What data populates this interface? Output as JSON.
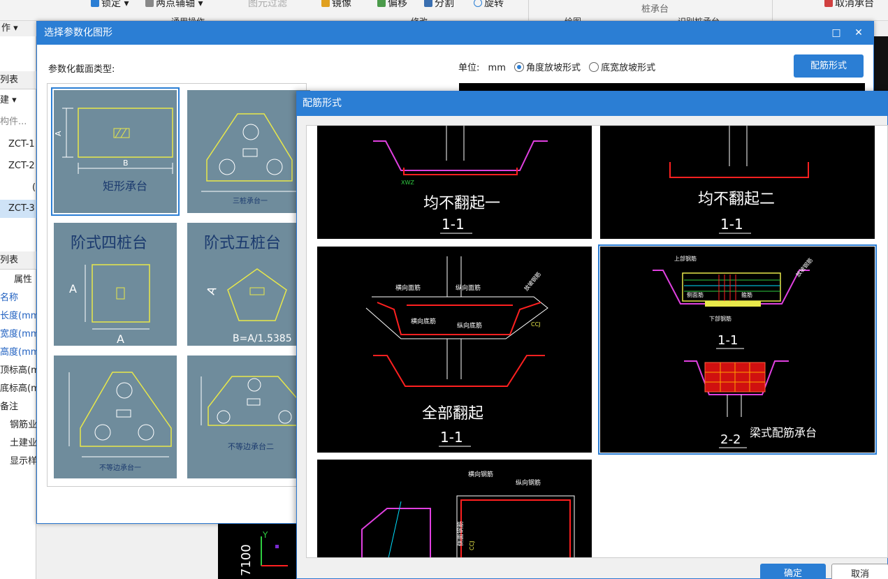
{
  "ribbon": {
    "lock": "锁定",
    "two_point_axis": "两点辅轴",
    "element_filter": "图元过滤",
    "mirror": "镜像",
    "offset": "偏移",
    "split": "分割",
    "rotate": "旋转",
    "pile_cap": "桩承台",
    "cancel_cap": "取消承台",
    "group_common": "通用操作",
    "group_modify": "修改",
    "group_draw": "绘图",
    "group_recognize": "识别桩承台",
    "work_menu": "作"
  },
  "left_panel": {
    "list_header": "列表",
    "new_label": "建",
    "search_placeholder": "构件...",
    "tree_items": [
      "ZCT-1",
      "ZCT-2",
      "(",
      "ZCT-3"
    ],
    "attr_header": "列表",
    "attr_col": "属性",
    "attr_rows": [
      "名称",
      "长度(mm",
      "宽度(mm",
      "高度(mm",
      "顶标高(m",
      "底标高(m",
      "备注",
      "钢筋业",
      "土建业",
      "显示样"
    ]
  },
  "dialog_main": {
    "title": "选择参数化图形",
    "section_type_label": "参数化截面类型:",
    "unit_label": "单位:",
    "unit_value": "mm",
    "radio_angle": "角度放坡形式",
    "radio_width": "底宽放坡形式",
    "rebar_button": "配筋形式",
    "tiles": [
      {
        "caption": "矩形承台",
        "label_a": "A",
        "label_b": "B"
      },
      {
        "caption": "三桩承台一"
      },
      {
        "caption": "阶式四桩台",
        "label_a": "A",
        "label_b": "A"
      },
      {
        "caption": "阶式五桩台",
        "label_a": "A",
        "label_b": "B=A/1.5385"
      },
      {
        "caption": "不等边承台一"
      },
      {
        "caption": "不等边承台二"
      }
    ]
  },
  "dialog_rebar": {
    "title": "配筋形式",
    "ok_button": "确定",
    "cancel_button": "取消",
    "cards": [
      {
        "caption": "均不翻起一",
        "section": "1-1",
        "tags": [
          "XWZ"
        ]
      },
      {
        "caption": "均不翻起二",
        "section": "1-1"
      },
      {
        "caption": "全部翻起",
        "section": "1-1",
        "tags": [
          "横向面筋",
          "纵向面筋",
          "横向底筋",
          "纵向底筋",
          "CCJ",
          "放坡钢筋"
        ]
      },
      {
        "caption": "梁式配筋承台",
        "section_a": "1-1",
        "section_b": "2-2",
        "tags": [
          "上部钢筋",
          "下部钢筋",
          "箍筋",
          "侧面筋",
          "放坡钢筋"
        ]
      },
      {
        "tags": [
          "横向钢筋",
          "纵向钢筋",
          "侧面钢筋",
          "CCJ"
        ]
      }
    ]
  },
  "bg_drawing": {
    "coord_value": "7100",
    "axis_label": "Y"
  }
}
